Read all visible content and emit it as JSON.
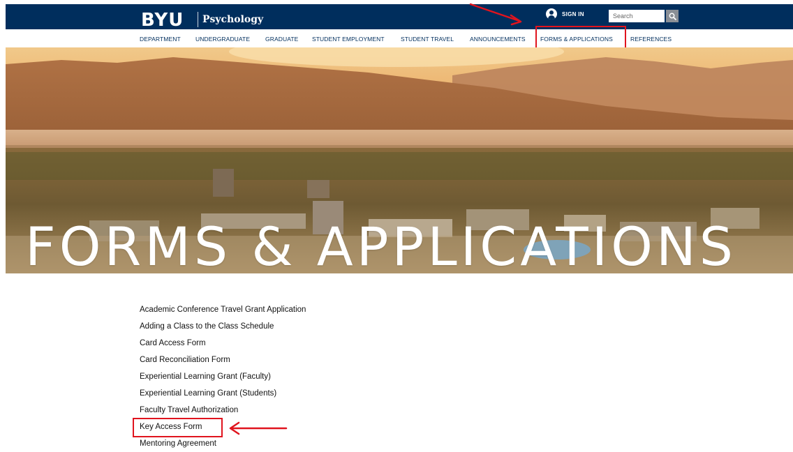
{
  "header": {
    "logo": "BYU",
    "department": "Psychology",
    "sign_in": "SIGN IN",
    "search_placeholder": "Search"
  },
  "nav": {
    "items": [
      "DEPARTMENT",
      "UNDERGRADUATE",
      "GRADUATE",
      "STUDENT EMPLOYMENT",
      "STUDENT TRAVEL",
      "ANNOUNCEMENTS",
      "FORMS & APPLICATIONS",
      "REFERENCES"
    ]
  },
  "hero": {
    "title": "FORMS & APPLICATIONS"
  },
  "forms": {
    "items": [
      "Academic Conference Travel Grant Application",
      "Adding a Class to the Class Schedule",
      "Card Access Form",
      "Card Reconciliation Form",
      "Experiential Learning Grant (Faculty)",
      "Experiential Learning Grant (Students)",
      "Faculty Travel Authorization",
      "Key Access Form",
      "Mentoring Agreement"
    ]
  },
  "colors": {
    "brand_navy": "#002e5d",
    "annotation_red": "#e0141e"
  },
  "icons": {
    "sign_in": "user-circle-icon",
    "search": "magnifier-icon"
  }
}
